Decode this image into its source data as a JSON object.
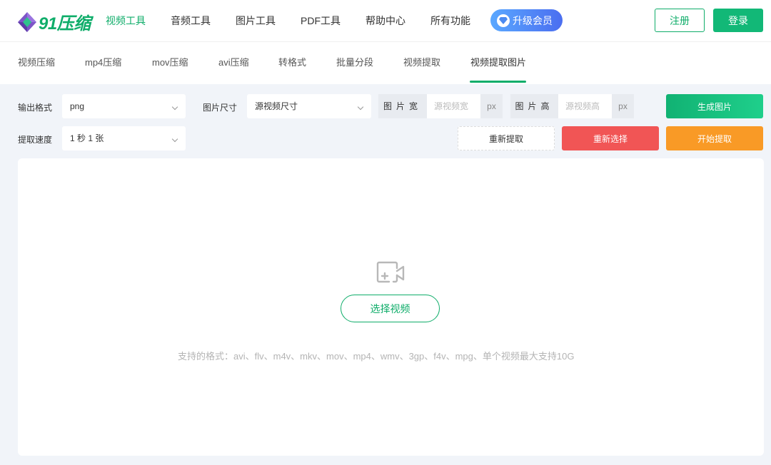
{
  "header": {
    "logo_text": "91压缩",
    "nav": [
      "视频工具",
      "音频工具",
      "图片工具",
      "PDF工具",
      "帮助中心",
      "所有功能"
    ],
    "vip_label": "升级会员",
    "register_label": "注册",
    "login_label": "登录"
  },
  "subnav": {
    "items": [
      "视频压缩",
      "mp4压缩",
      "mov压缩",
      "avi压缩",
      "转格式",
      "批量分段",
      "视频提取",
      "视频提取图片"
    ],
    "active_index": 7
  },
  "options": {
    "output_format_label": "输出格式",
    "output_format_value": "png",
    "image_size_label": "图片尺寸",
    "image_size_value": "源视频尺寸",
    "width_label": "图片宽",
    "width_placeholder": "源视频宽",
    "height_label": "图片高",
    "height_placeholder": "源视频高",
    "unit": "px",
    "speed_label": "提取速度",
    "speed_value": "1 秒 1 张"
  },
  "actions": {
    "generate": "生成图片",
    "reextract": "重新提取",
    "reselect": "重新选择",
    "start": "开始提取"
  },
  "upload": {
    "choose_label": "选择视频",
    "hint": "支持的格式：avi、flv、m4v、mkv、mov、mp4、wmv、3gp、f4v、mpg、单个视频最大支持10G"
  },
  "colors": {
    "brand": "#0fad6a",
    "danger": "#f15555",
    "warning": "#f99a26",
    "vip_start": "#5aa8ff",
    "vip_end": "#4b6ef0"
  }
}
